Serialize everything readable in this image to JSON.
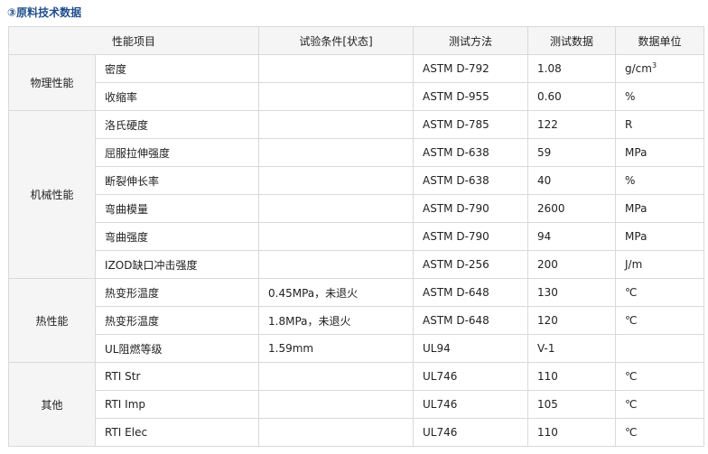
{
  "section_title": "③原料技术数据",
  "headers": [
    "性能项目",
    "试验条件[状态]",
    "测试方法",
    "测试数据",
    "数据单位"
  ],
  "groups": [
    {
      "category": "物理性能",
      "rows": [
        {
          "property": "密度",
          "condition": "",
          "method": "ASTM D-792",
          "value": "1.08",
          "unit": "g/cm",
          "unit_sup": "3"
        },
        {
          "property": "收缩率",
          "condition": "",
          "method": "ASTM D-955",
          "value": "0.60",
          "unit": "%"
        }
      ]
    },
    {
      "category": "机械性能",
      "rows": [
        {
          "property": "洛氏硬度",
          "condition": "",
          "method": "ASTM D-785",
          "value": "122",
          "unit": "R"
        },
        {
          "property": "屈服拉伸强度",
          "condition": "",
          "method": "ASTM D-638",
          "value": "59",
          "unit": "MPa"
        },
        {
          "property": "断裂伸长率",
          "condition": "",
          "method": "ASTM D-638",
          "value": "40",
          "unit": "%"
        },
        {
          "property": "弯曲模量",
          "condition": "",
          "method": "ASTM D-790",
          "value": "2600",
          "unit": "MPa"
        },
        {
          "property": "弯曲强度",
          "condition": "",
          "method": "ASTM D-790",
          "value": "94",
          "unit": "MPa"
        },
        {
          "property": "IZOD缺口冲击强度",
          "condition": "",
          "method": "ASTM D-256",
          "value": "200",
          "unit": "J/m"
        }
      ]
    },
    {
      "category": "热性能",
      "rows": [
        {
          "property": "热变形温度",
          "condition": "0.45MPa，未退火",
          "method": "ASTM D-648",
          "value": "130",
          "unit": "℃"
        },
        {
          "property": "热变形温度",
          "condition": "1.8MPa，未退火",
          "method": "ASTM D-648",
          "value": "120",
          "unit": "℃"
        },
        {
          "property": "UL阻燃等级",
          "condition": "1.59mm",
          "method": "UL94",
          "value": "V-1",
          "unit": ""
        }
      ]
    },
    {
      "category": "其他",
      "rows": [
        {
          "property": "RTI Str",
          "condition": "",
          "method": "UL746",
          "value": "110",
          "unit": "℃"
        },
        {
          "property": "RTI Imp",
          "condition": "",
          "method": "UL746",
          "value": "105",
          "unit": "℃"
        },
        {
          "property": "RTI Elec",
          "condition": "",
          "method": "UL746",
          "value": "110",
          "unit": "℃"
        }
      ]
    }
  ]
}
